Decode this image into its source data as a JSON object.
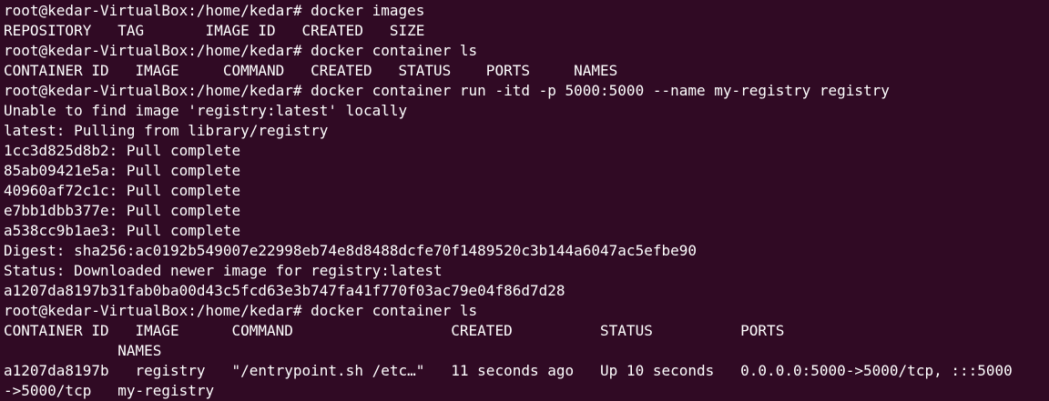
{
  "terminal": {
    "background": "#300a24",
    "foreground": "#ffffff",
    "lines": [
      "root@kedar-VirtualBox:/home/kedar# docker images",
      "REPOSITORY   TAG       IMAGE ID   CREATED   SIZE",
      "root@kedar-VirtualBox:/home/kedar# docker container ls",
      "CONTAINER ID   IMAGE     COMMAND   CREATED   STATUS    PORTS     NAMES",
      "root@kedar-VirtualBox:/home/kedar# docker container run -itd -p 5000:5000 --name my-registry registry",
      "Unable to find image 'registry:latest' locally",
      "latest: Pulling from library/registry",
      "1cc3d825d8b2: Pull complete",
      "85ab09421e5a: Pull complete",
      "40960af72c1c: Pull complete",
      "e7bb1dbb377e: Pull complete",
      "a538cc9b1ae3: Pull complete",
      "Digest: sha256:ac0192b549007e22998eb74e8d8488dcfe70f1489520c3b144a6047ac5efbe90",
      "Status: Downloaded newer image for registry:latest",
      "a1207da8197b31fab0ba00d43c5fcd63e3b747fa41f770f03ac79e04f86d7d28",
      "root@kedar-VirtualBox:/home/kedar# docker container ls",
      "CONTAINER ID   IMAGE      COMMAND                  CREATED          STATUS          PORTS",
      "             NAMES",
      "a1207da8197b   registry   \"/entrypoint.sh /etc…\"   11 seconds ago   Up 10 seconds   0.0.0.0:5000->5000/tcp, :::5000",
      "->5000/tcp   my-registry"
    ]
  }
}
